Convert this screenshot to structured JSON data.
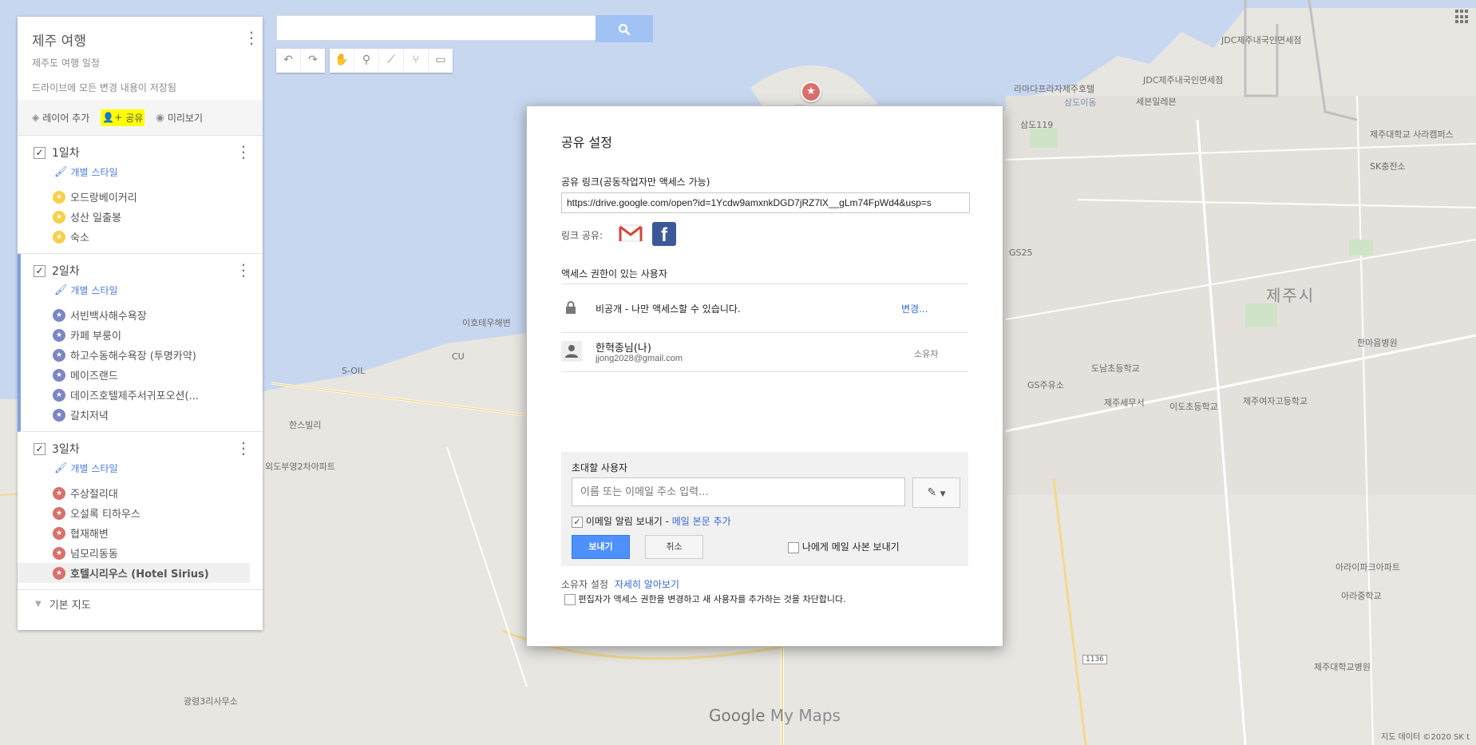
{
  "map": {
    "labels": {
      "jeju_city": "제주시",
      "jdc_top": "JDC제주내국인면세점",
      "jdc_mid": "JDC제주내국인면세점",
      "ramada": "라마다프라자제주호텔",
      "sejong": "세븐일레븐",
      "sangdo": "삼도이동",
      "samdo119": "삼도119",
      "jeju_univ": "제주대학교 사라캠퍼스",
      "sk_station": "SK충전소",
      "jeju_girls": "제주여자고등학교",
      "jeju_hospital": "제주대학교병원",
      "ido_elem": "이도초등학교",
      "gs25": "GS25",
      "cu": "CU",
      "yongdam": "이호테우해변",
      "s_oil": "S-OIL",
      "jeju_airport_road": "외도부영2차아파트",
      "road_1136": "1136",
      "gwangnyeong": "광령3리사무소",
      "hanan": "한스빌리",
      "hanmaeul": "한마음병원",
      "arajung": "아라중학교",
      "ara_park": "아라이파크아파트",
      "gs_sk": "GS주유소",
      "dosi": "도남초등학교",
      "sejeong": "제주세무서"
    },
    "watermark_google": "Google",
    "watermark_mymaps": "My Maps",
    "copyright": "지도 데이터 ©2020 SK t"
  },
  "search": {
    "placeholder": "",
    "value": ""
  },
  "toolbar": {
    "undo_icon": "undo-icon",
    "redo_icon": "redo-icon",
    "hand_icon": "hand-icon",
    "marker_icon": "marker-icon",
    "line_icon": "draw-line-icon",
    "route_icon": "route-icon",
    "measure_icon": "ruler-icon"
  },
  "panel": {
    "title": "제주 여행",
    "subtitle": "제주도 여행 일정",
    "saved_text": "드라이브에 모든 변경 내용이 저장됨",
    "actions": {
      "add_layer": "레이어 추가",
      "share": "공유",
      "preview": "미리보기"
    },
    "layers": [
      {
        "name": "1일차",
        "style_label": "개별 스타일",
        "color": "#f7d04a",
        "places": [
          "오드랑베이커리",
          "성산 일출봉",
          "숙소"
        ]
      },
      {
        "name": "2일차",
        "style_label": "개별 스타일",
        "color": "#7d86c4",
        "places": [
          "서빈백사해수욕장",
          "카페 부룽이",
          "하고수동해수욕장 (투명카약)",
          "메이즈랜드",
          "데이즈호텔제주서귀포오션(...",
          "갈치저녁"
        ]
      },
      {
        "name": "3일차",
        "style_label": "개별 스타일",
        "color": "#d9706b",
        "places": [
          "주상절리대",
          "오설록 티하우스",
          "협재해변",
          "넘모리동동",
          "호텔시리우스 (Hotel Sirius)"
        ]
      }
    ],
    "basemap_label": "기본 지도"
  },
  "dialog": {
    "title": "공유 설정",
    "link_label": "공유 링크(공동작업자만 액세스 가능)",
    "link_value": "https://drive.google.com/open?id=1Ycdw9amxnkDGD7jRZ7lX__gLm74FpWd4&usp=s",
    "share_via_label": "링크 공유:",
    "access_header": "액세스 권한이 있는 사용자",
    "privacy_text": "비공개 - 나만 액세스할 수 있습니다.",
    "change_link": "변경...",
    "owner_name": "한혁종님(나)",
    "owner_email": "jjong2028@gmail.com",
    "owner_role": "소유자",
    "invite_label": "초대할 사용자",
    "invite_placeholder": "이름 또는 이메일 주소 입력...",
    "notify_label": "이메일 알림 보내기 -",
    "add_message_link": "메일 본문 추가",
    "send_copy_label": "나에게 메일 사본 보내기",
    "send_button": "보내기",
    "cancel_button": "취소",
    "owner_settings_label": "소유자 설정",
    "learn_more_link": "자세히 알아보기",
    "prevent_editors_label": "편집자가 액세스 권한을 변경하고 새 사용자를 추가하는 것을 차단합니다.",
    "notify_checked": true,
    "send_copy_checked": false,
    "prevent_checked": false
  }
}
